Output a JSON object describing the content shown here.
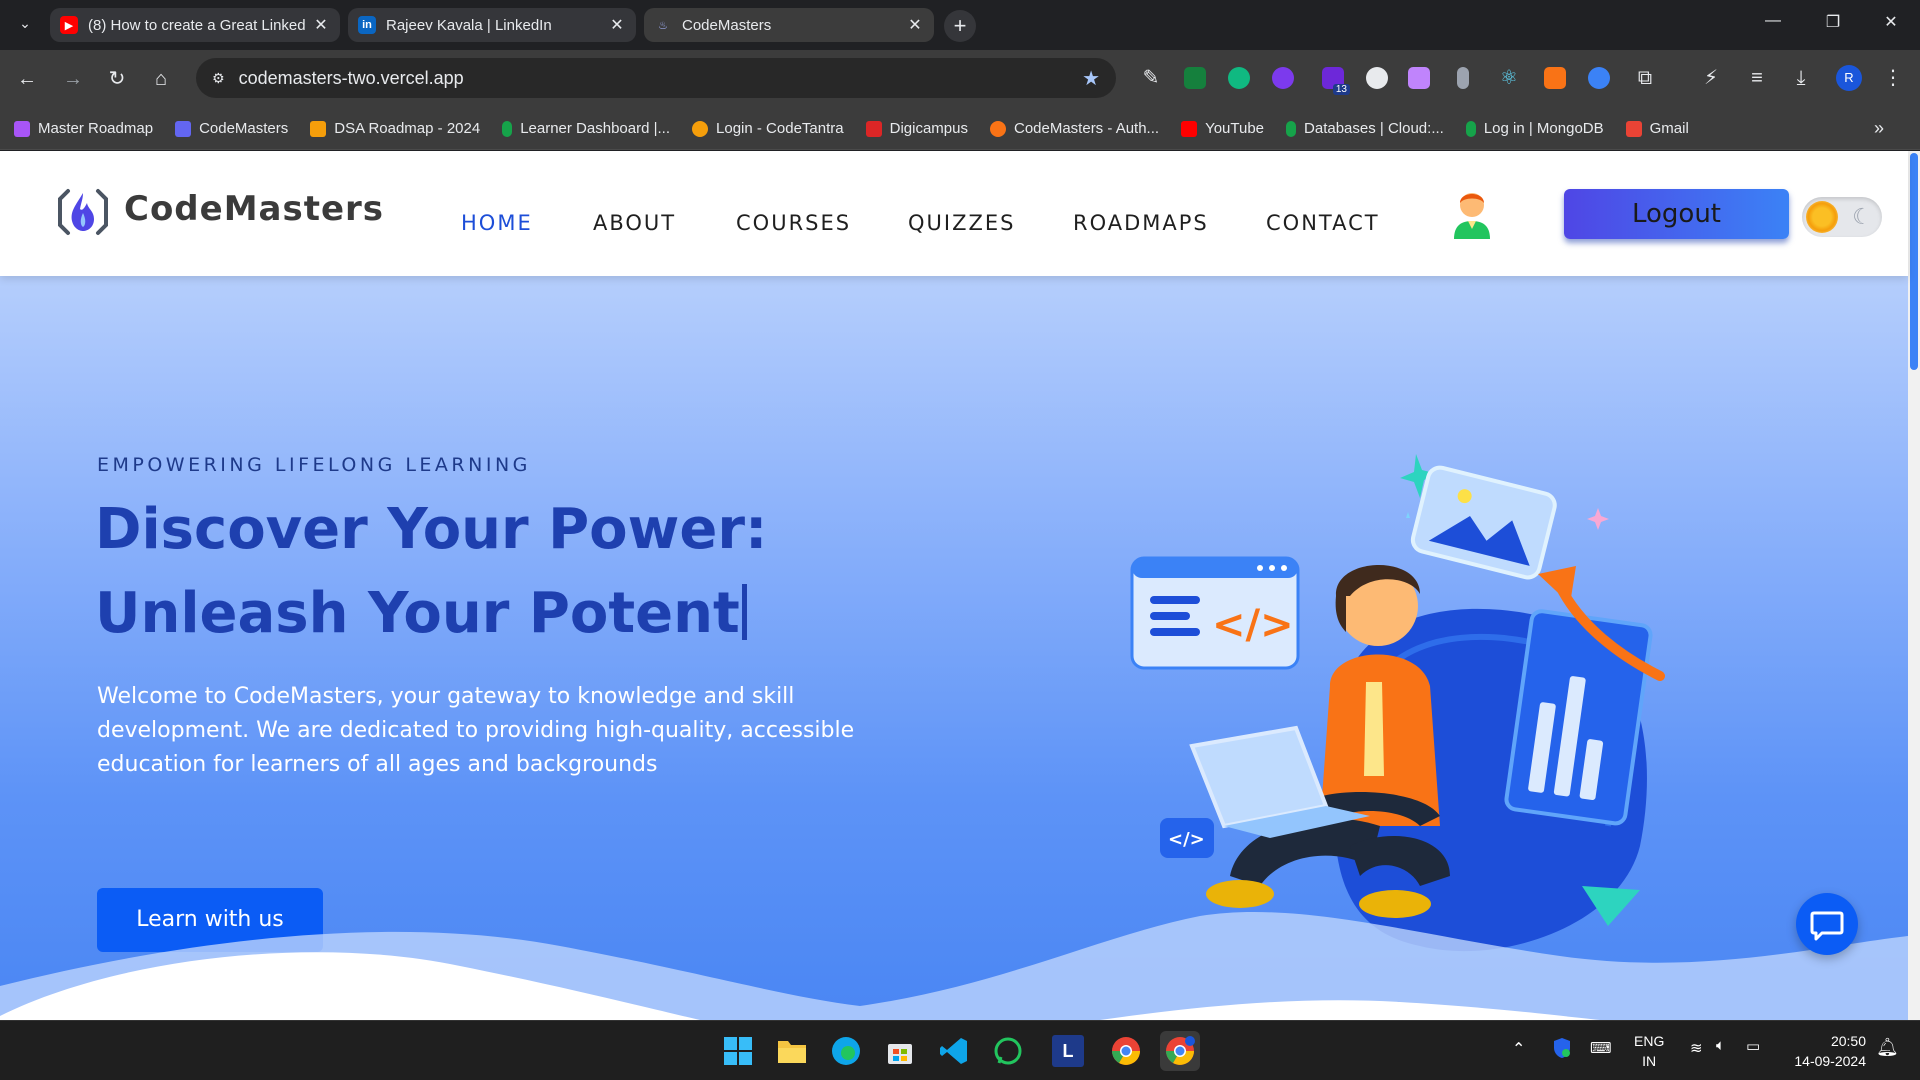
{
  "browser": {
    "tabs": [
      {
        "title": "(8) How to create a Great Linked",
        "favicon": "youtube-icon",
        "color": "#ff0000"
      },
      {
        "title": "Rajeev Kavala | LinkedIn",
        "favicon": "linkedin-icon",
        "color": "#0a66c2"
      },
      {
        "title": "CodeMasters",
        "favicon": "codemasters-icon",
        "color": "#6366f1"
      }
    ],
    "url": "codemasters-two.vercel.app",
    "extension_badge": "13",
    "profile_initial": "R",
    "bookmarks": [
      {
        "label": "Master Roadmap",
        "color": "#a855f7"
      },
      {
        "label": "CodeMasters",
        "color": "#6366f1"
      },
      {
        "label": "DSA Roadmap - 2024",
        "color": "#f59e0b"
      },
      {
        "label": "Learner Dashboard |...",
        "color": "#16a34a"
      },
      {
        "label": "Login - CodeTantra",
        "color": "#f59e0b"
      },
      {
        "label": "Digicampus",
        "color": "#dc2626"
      },
      {
        "label": "CodeMasters - Auth...",
        "color": "#f97316"
      },
      {
        "label": "YouTube",
        "color": "#ff0000"
      },
      {
        "label": "Databases | Cloud:...",
        "color": "#16a34a"
      },
      {
        "label": "Log in | MongoDB",
        "color": "#16a34a"
      },
      {
        "label": "Gmail",
        "color": "#ea4335"
      }
    ]
  },
  "site": {
    "brand": "CodeMasters",
    "nav": [
      "HOME",
      "ABOUT",
      "COURSES",
      "QUIZZES",
      "ROADMAPS",
      "CONTACT"
    ],
    "active_nav": "HOME",
    "logout_label": "Logout",
    "hero": {
      "eyebrow": "EMPOWERING LIFELONG LEARNING",
      "headline_line1": "Discover Your Power:",
      "headline_line2": "Unleash Your Potent",
      "lead": "Welcome to CodeMasters, your gateway to knowledge and skill development. We are dedicated to providing high-quality, accessible education for learners of all ages and backgrounds",
      "cta_label": "Learn with us"
    },
    "colors": {
      "accent": "#1d4ed8",
      "button": "#0b5cf5",
      "hero_top": "#b5cefc",
      "hero_bottom": "#4a86f3"
    }
  },
  "taskbar": {
    "apps": [
      "windows-start-icon",
      "file-explorer-icon",
      "edge-icon",
      "store-icon",
      "vscode-icon",
      "whatsapp-icon",
      "l-app-icon",
      "chrome-icon",
      "chrome-profile-icon"
    ],
    "l_app_label": "L",
    "lang_line1": "ENG",
    "lang_line2": "IN",
    "time": "20:50",
    "date": "14-09-2024"
  }
}
